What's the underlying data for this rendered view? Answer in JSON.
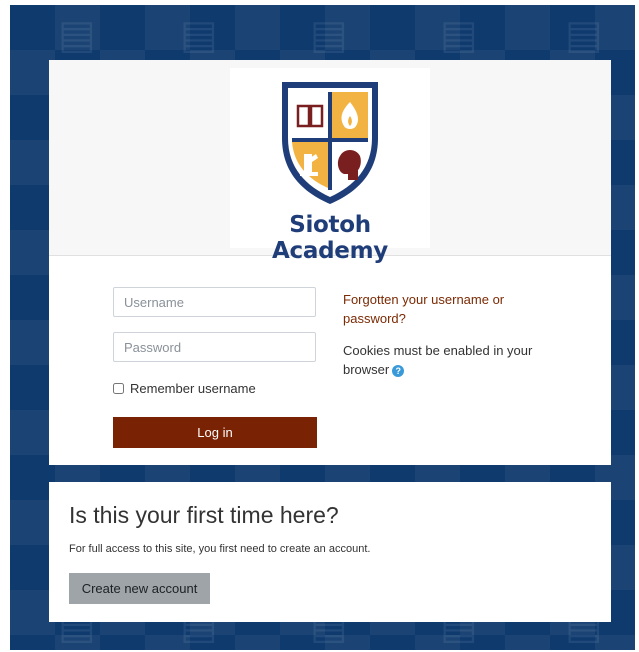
{
  "site": {
    "name": "Siotoh Academy",
    "brand_color": "#1f3d78"
  },
  "login": {
    "username_placeholder": "Username",
    "password_placeholder": "Password",
    "remember_label": "Remember username",
    "remember_checked": false,
    "login_button": "Log in",
    "login_button_color": "#7a2204",
    "forgot_link": "Forgotten your username or password?",
    "cookies_notice": "Cookies must be enabled in your browser",
    "help_icon": "question-circle-icon"
  },
  "first_time": {
    "heading": "Is this your first time here?",
    "description": "For full access to this site, you first need to create an account.",
    "create_button": "Create new account"
  },
  "colors": {
    "background": "#0f3a6e",
    "shield_gold": "#f2b342",
    "shield_red": "#7a1f1f"
  }
}
